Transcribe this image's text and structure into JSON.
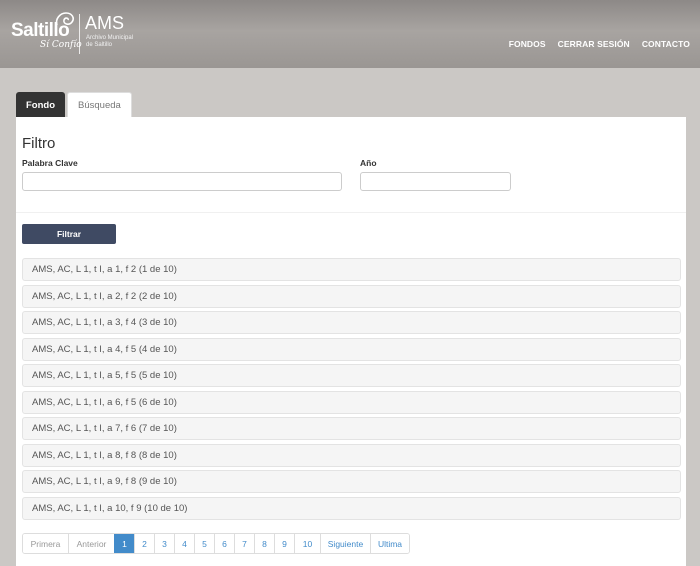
{
  "header": {
    "logo_text": "Saltillo",
    "logo_slogan": "Sí Confío",
    "logo_acronym": "AMS",
    "logo_subtitle": "Archivo Municipal de Saltillo",
    "nav": [
      "FONDOS",
      "CERRAR SESIÓN",
      "CONTACTO"
    ]
  },
  "tabs": [
    {
      "label": "Fondo",
      "active": true
    },
    {
      "label": "Búsqueda",
      "active": false
    }
  ],
  "filter": {
    "title": "Filtro",
    "keyword_label": "Palabra Clave",
    "keyword_value": "",
    "year_label": "Año",
    "year_value": "",
    "button_label": "Filtrar"
  },
  "results": [
    "AMS, AC, L 1, t I, a 1, f 2 (1 de 10)",
    "AMS, AC, L 1, t I, a 2, f 2 (2 de 10)",
    "AMS, AC, L 1, t I, a 3, f 4 (3 de 10)",
    "AMS, AC, L 1, t I, a 4, f 5 (4 de 10)",
    "AMS, AC, L 1, t I, a 5, f 5 (5 de 10)",
    "AMS, AC, L 1, t I, a 6, f 5 (6 de 10)",
    "AMS, AC, L 1, t I, a 7, f 6 (7 de 10)",
    "AMS, AC, L 1, t I, a 8, f 8 (8 de 10)",
    "AMS, AC, L 1, t I, a 9, f 8 (9 de 10)",
    "AMS, AC, L 1, t I, a 10, f 9 (10 de 10)"
  ],
  "pagination": {
    "first": "Primera",
    "prev": "Anterior",
    "pages": [
      "1",
      "2",
      "3",
      "4",
      "5",
      "6",
      "7",
      "8",
      "9",
      "10"
    ],
    "current": "1",
    "next": "Siguiente",
    "last": "Ultima"
  },
  "colors": {
    "primary_button": "#3f4a63",
    "active_page": "#428bca",
    "header_bg": "#9a9693"
  }
}
